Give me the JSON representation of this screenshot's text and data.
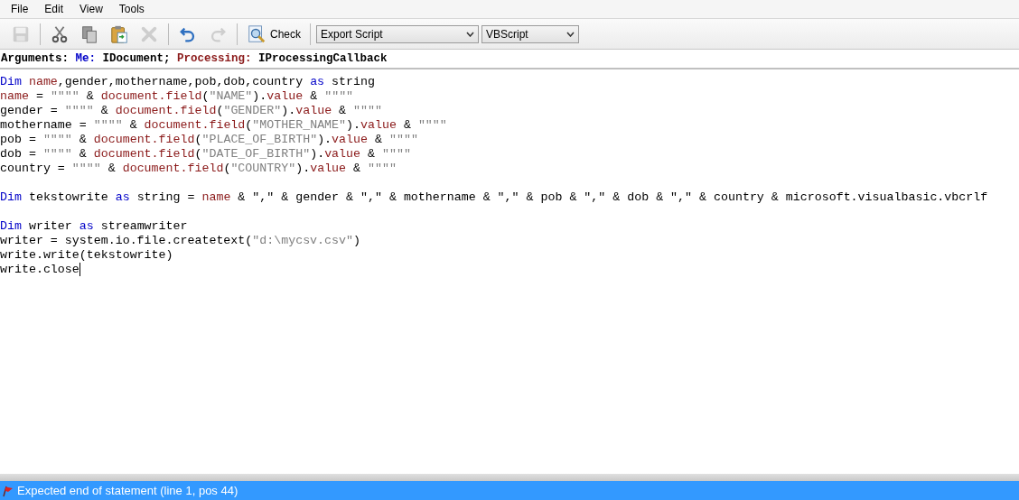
{
  "menu": [
    "File",
    "Edit",
    "View",
    "Tools"
  ],
  "toolbar": {
    "buttons": [
      {
        "kind": "save",
        "disabled": true
      },
      {
        "kind": "cut",
        "disabled": false
      },
      {
        "kind": "copy",
        "disabled": false
      },
      {
        "kind": "paste",
        "disabled": false
      },
      {
        "kind": "delete",
        "disabled": true
      },
      {
        "kind": "undo",
        "disabled": false
      },
      {
        "kind": "redo",
        "disabled": true
      }
    ],
    "check_button": "Check",
    "script_select": "Export Script",
    "language_select": "VBScript"
  },
  "arguments": [
    {
      "kind": "text",
      "text": "Arguments: "
    },
    {
      "kind": "keyword",
      "text": "Me:"
    },
    {
      "kind": "text",
      "text": " IDocument; "
    },
    {
      "kind": "member",
      "text": "Processing:"
    },
    {
      "kind": "text",
      "text": " IProcessingCallback"
    }
  ],
  "code_lines": [
    {
      "tokens": [
        {
          "kind": "keyword",
          "text": "Dim "
        },
        {
          "kind": "member",
          "text": "name"
        },
        {
          "kind": "text",
          "text": ",gender,mothername,pob,dob,country "
        },
        {
          "kind": "keyword",
          "text": "as"
        },
        {
          "kind": "text",
          "text": " string"
        }
      ]
    },
    {
      "tokens": [
        {
          "kind": "member",
          "text": "name"
        },
        {
          "kind": "text",
          "text": " = "
        },
        {
          "kind": "string",
          "text": "\"\"\"\""
        },
        {
          "kind": "text",
          "text": " & "
        },
        {
          "kind": "member",
          "text": "document.field"
        },
        {
          "kind": "text",
          "text": "("
        },
        {
          "kind": "string",
          "text": "\"NAME\""
        },
        {
          "kind": "text",
          "text": ")."
        },
        {
          "kind": "member",
          "text": "value"
        },
        {
          "kind": "text",
          "text": " & "
        },
        {
          "kind": "string",
          "text": "\"\"\"\""
        }
      ]
    },
    {
      "tokens": [
        {
          "kind": "text",
          "text": "gender = "
        },
        {
          "kind": "string",
          "text": "\"\"\"\""
        },
        {
          "kind": "text",
          "text": " & "
        },
        {
          "kind": "member",
          "text": "document.field"
        },
        {
          "kind": "text",
          "text": "("
        },
        {
          "kind": "string",
          "text": "\"GENDER\""
        },
        {
          "kind": "text",
          "text": ")."
        },
        {
          "kind": "member",
          "text": "value"
        },
        {
          "kind": "text",
          "text": " & "
        },
        {
          "kind": "string",
          "text": "\"\"\"\""
        }
      ]
    },
    {
      "tokens": [
        {
          "kind": "text",
          "text": "mothername = "
        },
        {
          "kind": "string",
          "text": "\"\"\"\""
        },
        {
          "kind": "text",
          "text": " & "
        },
        {
          "kind": "member",
          "text": "document.field"
        },
        {
          "kind": "text",
          "text": "("
        },
        {
          "kind": "string",
          "text": "\"MOTHER_NAME\""
        },
        {
          "kind": "text",
          "text": ")."
        },
        {
          "kind": "member",
          "text": "value"
        },
        {
          "kind": "text",
          "text": " & "
        },
        {
          "kind": "string",
          "text": "\"\"\"\""
        }
      ]
    },
    {
      "tokens": [
        {
          "kind": "text",
          "text": "pob = "
        },
        {
          "kind": "string",
          "text": "\"\"\"\""
        },
        {
          "kind": "text",
          "text": " & "
        },
        {
          "kind": "member",
          "text": "document.field"
        },
        {
          "kind": "text",
          "text": "("
        },
        {
          "kind": "string",
          "text": "\"PLACE_OF_BIRTH\""
        },
        {
          "kind": "text",
          "text": ")."
        },
        {
          "kind": "member",
          "text": "value"
        },
        {
          "kind": "text",
          "text": " & "
        },
        {
          "kind": "string",
          "text": "\"\"\"\""
        }
      ]
    },
    {
      "tokens": [
        {
          "kind": "text",
          "text": "dob = "
        },
        {
          "kind": "string",
          "text": "\"\"\"\""
        },
        {
          "kind": "text",
          "text": " & "
        },
        {
          "kind": "member",
          "text": "document.field"
        },
        {
          "kind": "text",
          "text": "("
        },
        {
          "kind": "string",
          "text": "\"DATE_OF_BIRTH\""
        },
        {
          "kind": "text",
          "text": ")."
        },
        {
          "kind": "member",
          "text": "value"
        },
        {
          "kind": "text",
          "text": " & "
        },
        {
          "kind": "string",
          "text": "\"\"\"\""
        }
      ]
    },
    {
      "tokens": [
        {
          "kind": "text",
          "text": "country = "
        },
        {
          "kind": "string",
          "text": "\"\"\"\""
        },
        {
          "kind": "text",
          "text": " & "
        },
        {
          "kind": "member",
          "text": "document.field"
        },
        {
          "kind": "text",
          "text": "("
        },
        {
          "kind": "string",
          "text": "\"COUNTRY\""
        },
        {
          "kind": "text",
          "text": ")."
        },
        {
          "kind": "member",
          "text": "value"
        },
        {
          "kind": "text",
          "text": " & "
        },
        {
          "kind": "string",
          "text": "\"\"\"\""
        }
      ]
    },
    {
      "kind": "blank"
    },
    {
      "tokens": [
        {
          "kind": "keyword",
          "text": "Dim"
        },
        {
          "kind": "text",
          "text": " tekstowrite "
        },
        {
          "kind": "keyword",
          "text": "as"
        },
        {
          "kind": "text",
          "text": " string = "
        },
        {
          "kind": "member",
          "text": "name"
        },
        {
          "kind": "text",
          "text": " & \",\" & gender & \",\" & mothername & \",\" & pob & \",\" & dob & \",\" & country & microsoft.visualbasic.vbcrlf"
        }
      ]
    },
    {
      "kind": "blank"
    },
    {
      "tokens": [
        {
          "kind": "keyword",
          "text": "Dim"
        },
        {
          "kind": "text",
          "text": " writer "
        },
        {
          "kind": "keyword",
          "text": "as"
        },
        {
          "kind": "text",
          "text": " streamwriter"
        }
      ]
    },
    {
      "tokens": [
        {
          "kind": "text",
          "text": "writer = system.io.file.createtext("
        },
        {
          "kind": "string",
          "text": "\"d:\\mycsv.csv\""
        },
        {
          "kind": "text",
          "text": ")"
        }
      ]
    },
    {
      "tokens": [
        {
          "kind": "text",
          "text": "write.write(tekstowrite)"
        }
      ]
    },
    {
      "tokens": [
        {
          "kind": "text",
          "text": "write.close"
        }
      ],
      "cursor": true
    }
  ],
  "status_bar": {
    "message": "Expected end of statement (line 1, pos 44)"
  }
}
